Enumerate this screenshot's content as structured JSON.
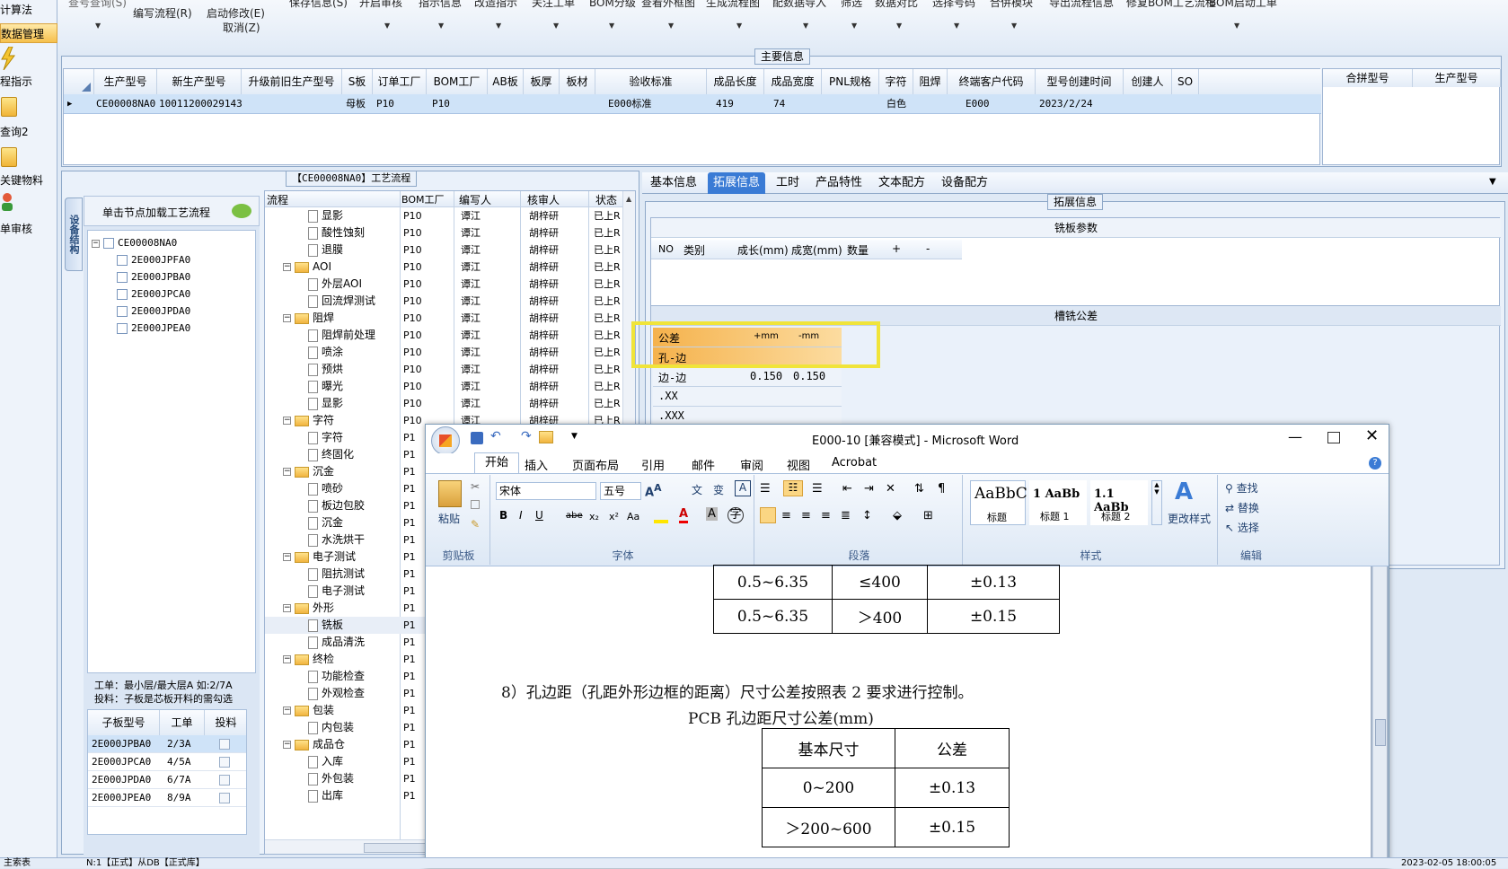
{
  "leftnav": {
    "items": [
      "计算法",
      "数据管理",
      "程指示",
      "查询2",
      "关键物料",
      "单审核"
    ]
  },
  "topmenu": {
    "items": [
      "查号查询(S)",
      "编写流程(R)",
      "启动修改(E)",
      "取消(Z)",
      "保存信息(S)",
      "开启审核",
      "指示信息",
      "改造指示",
      "关注工单",
      "BOM分级",
      "查看外框图",
      "生成流程图",
      "配数据导入",
      "筛选",
      "数据对比",
      "选择号码",
      "合併模块",
      "导出流程信息",
      "修复BOM工艺流程",
      "BOM启动工单"
    ]
  },
  "main_info": {
    "label": "主要信息",
    "columns": [
      "生产型号",
      "新生产型号",
      "升级前旧生产型号",
      "S板",
      "订单工厂",
      "BOM工厂",
      "AB板",
      "板厚",
      "板材",
      "验收标准",
      "成品长度",
      "成品宽度",
      "PNL规格",
      "字符",
      "阻焊",
      "终端客户代码",
      "型号创建时间",
      "创建人",
      "SO"
    ],
    "row": {
      "生产型号": "CE00008NA0",
      "新生产型号": "10011200029143",
      "S板": "母板",
      "订单工厂": "P10",
      "BOM工厂": "P10",
      "验收标准": "E000标准",
      "成品长度": "419",
      "成品宽度": "74",
      "字符": "白色",
      "终端客户代码": "E000",
      "型号创建时间": "2023/2/24"
    },
    "side_columns": [
      "合拼型号",
      "生产型号"
    ]
  },
  "process": {
    "title": "【CE00008NA0】工艺流程",
    "vtab": "设备结构",
    "click_hint": "单击节点加载工艺流程",
    "tree_root": "CE00008NA0",
    "tree_children": [
      "2E000JPFA0",
      "2E000JPBA0",
      "2E000JPCA0",
      "2E000JPDA0",
      "2E000JPEA0"
    ],
    "workorder_note": "工单：最小层/最大层A 如:2/7A",
    "feed_note": "投料：子板是芯板开料的需勾选",
    "sub_columns": [
      "子板型号",
      "工单",
      "投料"
    ],
    "sub_rows": [
      [
        "2E000JPBA0",
        "2/3A"
      ],
      [
        "2E000JPCA0",
        "4/5A"
      ],
      [
        "2E000JPDA0",
        "6/7A"
      ],
      [
        "2E000JPEA0",
        "8/9A"
      ]
    ],
    "flow_columns": [
      "流程",
      "BOM工厂",
      "编写人",
      "核审人",
      "状态"
    ],
    "flow_rows": [
      {
        "name": "显影",
        "lvl": 2,
        "factory": "P10",
        "writer": "谭江",
        "auditor": "胡梓研",
        "status": "已上R"
      },
      {
        "name": "酸性蚀刻",
        "lvl": 2,
        "factory": "P10",
        "writer": "谭江",
        "auditor": "胡梓研",
        "status": "已上R"
      },
      {
        "name": "退膜",
        "lvl": 2,
        "factory": "P10",
        "writer": "谭江",
        "auditor": "胡梓研",
        "status": "已上R"
      },
      {
        "name": "AOI",
        "lvl": 1,
        "factory": "P10",
        "writer": "谭江",
        "auditor": "胡梓研",
        "status": "已上R"
      },
      {
        "name": "外层AOI",
        "lvl": 2,
        "factory": "P10",
        "writer": "谭江",
        "auditor": "胡梓研",
        "status": "已上R"
      },
      {
        "name": "回流焊测试",
        "lvl": 2,
        "factory": "P10",
        "writer": "谭江",
        "auditor": "胡梓研",
        "status": "已上R"
      },
      {
        "name": "阻焊",
        "lvl": 1,
        "factory": "P10",
        "writer": "谭江",
        "auditor": "胡梓研",
        "status": "已上R"
      },
      {
        "name": "阻焊前处理",
        "lvl": 2,
        "factory": "P10",
        "writer": "谭江",
        "auditor": "胡梓研",
        "status": "已上R"
      },
      {
        "name": "喷涂",
        "lvl": 2,
        "factory": "P10",
        "writer": "谭江",
        "auditor": "胡梓研",
        "status": "已上R"
      },
      {
        "name": "预烘",
        "lvl": 2,
        "factory": "P10",
        "writer": "谭江",
        "auditor": "胡梓研",
        "status": "已上R"
      },
      {
        "name": "曝光",
        "lvl": 2,
        "factory": "P10",
        "writer": "谭江",
        "auditor": "胡梓研",
        "status": "已上R"
      },
      {
        "name": "显影",
        "lvl": 2,
        "factory": "P10",
        "writer": "谭江",
        "auditor": "胡梓研",
        "status": "已上R"
      },
      {
        "name": "字符",
        "lvl": 1,
        "factory": "P10",
        "writer": "谭江",
        "auditor": "胡梓研",
        "status": "已上R"
      },
      {
        "name": "字符",
        "lvl": 2,
        "factory": "P1",
        "writer": "",
        "auditor": "",
        "status": ""
      },
      {
        "name": "终固化",
        "lvl": 2,
        "factory": "P1",
        "writer": "",
        "auditor": "",
        "status": ""
      },
      {
        "name": "沉金",
        "lvl": 1,
        "factory": "P1",
        "writer": "",
        "auditor": "",
        "status": ""
      },
      {
        "name": "喷砂",
        "lvl": 2,
        "factory": "P1",
        "writer": "",
        "auditor": "",
        "status": ""
      },
      {
        "name": "板边包胶",
        "lvl": 2,
        "factory": "P1",
        "writer": "",
        "auditor": "",
        "status": ""
      },
      {
        "name": "沉金",
        "lvl": 2,
        "factory": "P1",
        "writer": "",
        "auditor": "",
        "status": ""
      },
      {
        "name": "水洗烘干",
        "lvl": 2,
        "factory": "P1",
        "writer": "",
        "auditor": "",
        "status": ""
      },
      {
        "name": "电子测试",
        "lvl": 1,
        "factory": "P1",
        "writer": "",
        "auditor": "",
        "status": ""
      },
      {
        "name": "阻抗测试",
        "lvl": 2,
        "factory": "P1",
        "writer": "",
        "auditor": "",
        "status": ""
      },
      {
        "name": "电子测试",
        "lvl": 2,
        "factory": "P1",
        "writer": "",
        "auditor": "",
        "status": ""
      },
      {
        "name": "外形",
        "lvl": 1,
        "factory": "P1",
        "writer": "",
        "auditor": "",
        "status": ""
      },
      {
        "name": "铣板",
        "lvl": 2,
        "factory": "P1",
        "writer": "",
        "auditor": "",
        "status": ""
      },
      {
        "name": "成品清洗",
        "lvl": 2,
        "factory": "P1",
        "writer": "",
        "auditor": "",
        "status": ""
      },
      {
        "name": "终检",
        "lvl": 1,
        "factory": "P1",
        "writer": "",
        "auditor": "",
        "status": ""
      },
      {
        "name": "功能检查",
        "lvl": 2,
        "factory": "P1",
        "writer": "",
        "auditor": "",
        "status": ""
      },
      {
        "name": "外观检查",
        "lvl": 2,
        "factory": "P1",
        "writer": "",
        "auditor": "",
        "status": ""
      },
      {
        "name": "包装",
        "lvl": 1,
        "factory": "P1",
        "writer": "",
        "auditor": "",
        "status": ""
      },
      {
        "name": "内包装",
        "lvl": 2,
        "factory": "P1",
        "writer": "",
        "auditor": "",
        "status": ""
      },
      {
        "name": "成品仓",
        "lvl": 1,
        "factory": "P1",
        "writer": "",
        "auditor": "",
        "status": ""
      },
      {
        "name": "入库",
        "lvl": 2,
        "factory": "P1",
        "writer": "",
        "auditor": "",
        "status": ""
      },
      {
        "name": "外包装",
        "lvl": 2,
        "factory": "P1",
        "writer": "",
        "auditor": "",
        "status": ""
      },
      {
        "name": "出库",
        "lvl": 2,
        "factory": "P1",
        "writer": "",
        "auditor": "",
        "status": ""
      }
    ]
  },
  "tabs": [
    "基本信息",
    "拓展信息",
    "工时",
    "产品特性",
    "文本配方",
    "设备配方"
  ],
  "active_tab": "拓展信息",
  "ext": {
    "label": "拓展信息",
    "mill_title": "铣板参数",
    "mill_columns": [
      "NO",
      "类别",
      "成长(mm)",
      "成宽(mm)",
      "数量",
      "+",
      "-"
    ],
    "slot_title": "槽铣公差",
    "tol_header": [
      "公差",
      "+mm",
      "-mm"
    ],
    "tol_rows": [
      [
        "孔-边",
        "",
        ""
      ],
      [
        "边-边",
        "0.150",
        "0.150"
      ],
      [
        ".XX",
        "",
        ""
      ],
      [
        ".XXX",
        "",
        ""
      ]
    ]
  },
  "word": {
    "title": "E000-10 [兼容模式] - Microsoft Word",
    "tabs": [
      "开始",
      "插入",
      "页面布局",
      "引用",
      "邮件",
      "审阅",
      "视图",
      "Acrobat"
    ],
    "paste": "粘贴",
    "clipboard": "剪贴板",
    "font_name": "宋体",
    "font_size": "五号",
    "font_group": "字体",
    "para_group": "段落",
    "styles": [
      "AaBbC",
      "1 AaBb",
      "1.1 AaBb"
    ],
    "style_names": [
      "标题",
      "标题 1",
      "标题 2"
    ],
    "change_styles": "更改样式",
    "styles_group": "样式",
    "find": "查找",
    "replace": "替换",
    "select": "选择",
    "edit_group": "编辑",
    "top_table": [
      [
        "0.5~6.35",
        "≤400",
        "±0.13"
      ],
      [
        "0.5~6.35",
        "＞400",
        "±0.15"
      ]
    ],
    "para8": "8）孔边距（孔距外形边框的距离）尺寸公差按照表 2 要求进行控制。",
    "caption": "PCB 孔边距尺寸公差(mm)",
    "table2_header": [
      "基本尺寸",
      "公差"
    ],
    "table2_rows": [
      [
        "0~200",
        "±0.13"
      ],
      [
        "＞200~600",
        "±0.15"
      ]
    ]
  },
  "statusbar": {
    "left": "主索表",
    "mid": "N:1【正式】从DB【正式库】",
    "right": "2023-02-05 18:00:05"
  }
}
